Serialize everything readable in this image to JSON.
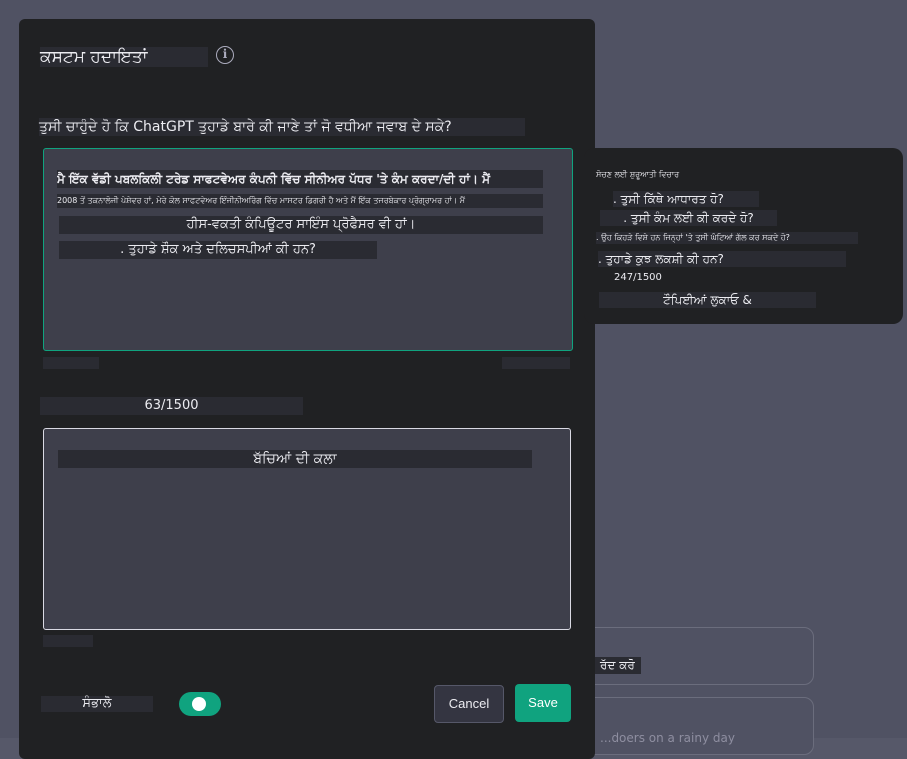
{
  "modal": {
    "title": "ਕਸਟਮ ਹਦਾਇਤਾਂ",
    "info_icon": "info-icon",
    "question1": "ਤੁਸੀ ਚਾਹੁੰਦੇ ਹੋ ਕਿ ChatGPT ਤੁਹਾਡੇ ਬਾਰੇ ਕੀ ਜਾਣੇ ਤਾਂ ਜੋ ਵਧੀਆ ਜਵਾਬ ਦੇ ਸਕੇ?",
    "textarea1": {
      "line1": "ਮੈ ਇੱਕ ਵੱਡੀ ਪਬਲਕਿਲੀ ਟਰੇਡ ਸਾਫਟਵੇਅਰ ਕੰਪਨੀ ਵਿੱਚ ਸੀਨੀਅਰ ਪੱਧਰ 'ਤੇ ਕੰਮ ਕਰਦਾ/ਦੀ ਹਾਂ। ਮੈਂ",
      "line2": "2008 ਤੋਂ ਤਕਨਾਲੋਜੀ ਪੇਸ਼ੇਵਰ ਹਾਂ, ਮੇਰੇ ਕੋਲ ਸਾਫਟਵੇਅਰ ਇੰਜੀਨੀਅਰਿੰਗ ਵਿੱਚ ਮਾਸਟਰ ਡਿਗਰੀ ਹੈ ਅਤੇ ਮੈਂ ਇੱਕ ਤਜਰਬੇਕਾਰ ਪ੍ਰੋਗ੍ਰਾਮਰ ਹਾਂ। ਮੈਂ",
      "line3": "ਹੀਸ-ਵਕਤੀ ਕੰਪਿਊਟਰ ਸਾਇੰਸ ਪ੍ਰੋਫੈਸਰ ਵੀ ਹਾਂ।",
      "line4": ". ਤੁਹਾਡੇ ਸ਼ੌਕ ਅਤੇ ਦਲਿਚਸਪੀਆਂ ਕੀ ਹਨ?"
    },
    "counter1": "63/1500",
    "textarea2": {
      "line1": "ਬੱਚਿਆਂ ਦੀ ਕਲਾ"
    },
    "toggle_label": "ਸੰਭਾਲੋ",
    "toggle_on": true,
    "cancel_label": "Cancel",
    "save_label": "Save"
  },
  "tooltip": {
    "heading": "ਸੋਚਣ ਲਈ ਸ਼ੁਰੂਆਤੀ ਵਿਚਾਰ",
    "items": [
      ". ਤੁਸੀ ਕਿੱਥੇ ਆਧਾਰਤ ਹੋ?",
      ". ਤੁਸੀ ਕੰਮ ਲਈ ਕੀ ਕਰਦੇ ਹੋ?",
      ". ਉਹ ਕਿਹੜੇ ਵਿਸ਼ੇ ਹਨ ਜਿਨ੍ਹਾਂ 'ਤੇ ਤੁਸੀ ਘੰਟਿਆਂ ਗੱਲ ਕਰ ਸਕਦੇ ਹੋ?",
      ". ਤੁਹਾਡੇ ਕੁਝ ਲਕਸ਼ੀ ਕੀ ਹਨ?"
    ],
    "counter": "247/1500",
    "hide_tips": "ਟੌਪਿਈਆਂ ਲੁਕਾਓ &"
  },
  "background": {
    "cancel_chip": "ਰੱਦ ਕਰੋ",
    "chip_text": "...doers on a rainy day"
  },
  "colors": {
    "accent": "#10a37f",
    "modal_bg": "#202123",
    "textarea_bg": "#3e3f4b"
  }
}
